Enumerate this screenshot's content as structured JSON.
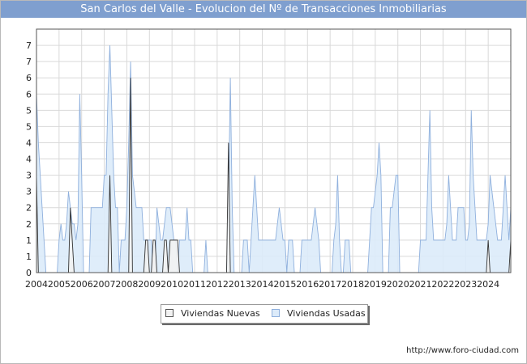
{
  "title": "San Carlos del Valle - Evolucion del Nº de Transacciones Inmobiliarias",
  "credit": "http://www.foro-ciudad.com",
  "colors": {
    "title_bg": "#7f9fcf",
    "nuevas_fill": "#f2f2f2",
    "nuevas_line": "#333333",
    "usadas_fill": "#dcebfa",
    "usadas_line": "#8fb0dd",
    "grid": "#d9d9d9"
  },
  "chart_data": {
    "type": "area",
    "title": "San Carlos del Valle - Evolucion del Nº de Transacciones Inmobiliarias",
    "x_tick_labels": [
      "2004",
      "2005",
      "2006",
      "2007",
      "2008",
      "2009",
      "2010",
      "2011",
      "2012",
      "2013",
      "2014",
      "2015",
      "2016",
      "2017",
      "2018",
      "2019",
      "2020",
      "2021",
      "2022",
      "2023",
      "2024"
    ],
    "y_tick_labels": [
      "0",
      "1",
      "1",
      "2",
      "2",
      "3",
      "3",
      "4",
      "4",
      "5",
      "5",
      "6",
      "6",
      "7",
      "7"
    ],
    "y_tick_values": [
      0,
      0.5,
      1,
      1.5,
      2,
      2.5,
      3,
      3.5,
      4,
      4.5,
      5,
      5.5,
      6,
      6.5,
      7
    ],
    "ylim": [
      0,
      7.5
    ],
    "grid": true,
    "legend_position": "bottom",
    "x_start_year": 2004,
    "points_per_year": 12,
    "series": [
      {
        "name": "Viviendas Nuevas",
        "values": [
          3,
          0,
          0,
          0,
          0,
          0,
          0,
          0,
          0,
          0,
          0,
          0,
          0,
          0,
          0,
          0,
          0,
          0,
          2,
          1,
          0,
          0,
          0,
          0,
          0,
          0,
          0,
          0,
          0,
          0,
          0,
          0,
          0,
          0,
          0,
          0,
          0,
          0,
          0,
          3,
          0,
          0,
          0,
          0,
          0,
          0,
          0,
          0,
          0,
          0,
          6,
          0,
          0,
          0,
          0,
          0,
          0,
          0,
          1,
          1,
          0,
          0,
          1,
          1,
          0,
          0,
          0,
          0,
          1,
          1,
          0,
          1,
          1,
          1,
          1,
          1,
          0,
          0,
          0,
          0,
          0,
          0,
          0,
          0,
          0,
          0,
          0,
          0,
          0,
          0,
          0,
          0,
          0,
          0,
          0,
          0,
          0,
          0,
          0,
          0,
          0,
          0,
          4,
          0,
          0,
          0,
          0,
          0,
          0,
          0,
          0,
          0,
          0,
          0,
          0,
          0,
          0,
          0,
          0,
          0,
          0,
          0,
          0,
          0,
          0,
          0,
          0,
          0,
          0,
          0,
          0,
          0,
          0,
          0,
          0,
          0,
          0,
          0,
          0,
          0,
          0,
          0,
          0,
          0,
          0,
          0,
          0,
          0,
          0,
          0,
          0,
          0,
          0,
          0,
          0,
          0,
          0,
          0,
          0,
          0,
          0,
          0,
          0,
          0,
          0,
          0,
          0,
          0,
          0,
          0,
          0,
          0,
          0,
          0,
          0,
          0,
          0,
          0,
          0,
          0,
          0,
          0,
          0,
          0,
          0,
          0,
          0,
          0,
          0,
          0,
          0,
          0,
          0,
          0,
          0,
          0,
          0,
          0,
          0,
          0,
          0,
          0,
          0,
          0,
          0,
          0,
          0,
          0,
          0,
          0,
          0,
          0,
          0,
          0,
          0,
          0,
          0,
          0,
          0,
          0,
          0,
          0,
          0,
          0,
          0,
          0,
          0,
          0,
          0,
          0,
          0,
          0,
          0,
          0,
          0,
          0,
          0,
          0,
          0,
          0,
          1,
          0,
          0,
          0,
          0,
          0,
          0,
          0,
          0,
          0,
          0,
          0,
          1
        ]
      },
      {
        "name": "Viviendas Usadas",
        "values": [
          5.5,
          4,
          3,
          2,
          1,
          0,
          0,
          0,
          0,
          0,
          0,
          0,
          1,
          1.5,
          1,
          1,
          1.5,
          2.5,
          2,
          1.5,
          1.5,
          1,
          1.5,
          5.5,
          3,
          0,
          0,
          0,
          0,
          2,
          2,
          2,
          2,
          2,
          2,
          2,
          3,
          3,
          5.5,
          7,
          5,
          3,
          2,
          2,
          0,
          1,
          1,
          1,
          2,
          4,
          6.5,
          3,
          2.5,
          2,
          2,
          2,
          2,
          1,
          1,
          1,
          1,
          1,
          0,
          0,
          2,
          1.5,
          1,
          1,
          1.5,
          2,
          2,
          2,
          1.5,
          1,
          1,
          0,
          1,
          1,
          1,
          1,
          2,
          1,
          1,
          0,
          0,
          0,
          0,
          0,
          0,
          0,
          1,
          0,
          0,
          0,
          0,
          0,
          0,
          0,
          0,
          0,
          0,
          0,
          2,
          6,
          2,
          0,
          0,
          0,
          0,
          0,
          1,
          1,
          1,
          0,
          1,
          2,
          3,
          2,
          1,
          1,
          1,
          1,
          1,
          1,
          1,
          1,
          1,
          1,
          1.5,
          2,
          1.5,
          1,
          1,
          0,
          1,
          1,
          1,
          0,
          0,
          0,
          0,
          1,
          1,
          1,
          1,
          1,
          1,
          1.5,
          2,
          1.5,
          1,
          0,
          0,
          0,
          0,
          0,
          0,
          0,
          1,
          1.5,
          3,
          1,
          0,
          0,
          1,
          1,
          1,
          0,
          0,
          0,
          0,
          0,
          0,
          0,
          0,
          0,
          0,
          1,
          2,
          2,
          2.5,
          3,
          4,
          3,
          0,
          0,
          0,
          0,
          2,
          2,
          2.5,
          3,
          3,
          0,
          0,
          0,
          0,
          0,
          0,
          0,
          0,
          0,
          0,
          0,
          1,
          1,
          1,
          1,
          3,
          5,
          2,
          1,
          1,
          1,
          1,
          1,
          1,
          1,
          1.5,
          3,
          2,
          1,
          1,
          1,
          2,
          2,
          2,
          2,
          1,
          1,
          1.5,
          5,
          3,
          2,
          1,
          1,
          1,
          1,
          1,
          1,
          1.5,
          3,
          2.5,
          2,
          1.5,
          1,
          1,
          1,
          2,
          3,
          2,
          1,
          2
        ]
      }
    ]
  },
  "legend": {
    "nuevas": "Viviendas Nuevas",
    "usadas": "Viviendas Usadas"
  }
}
